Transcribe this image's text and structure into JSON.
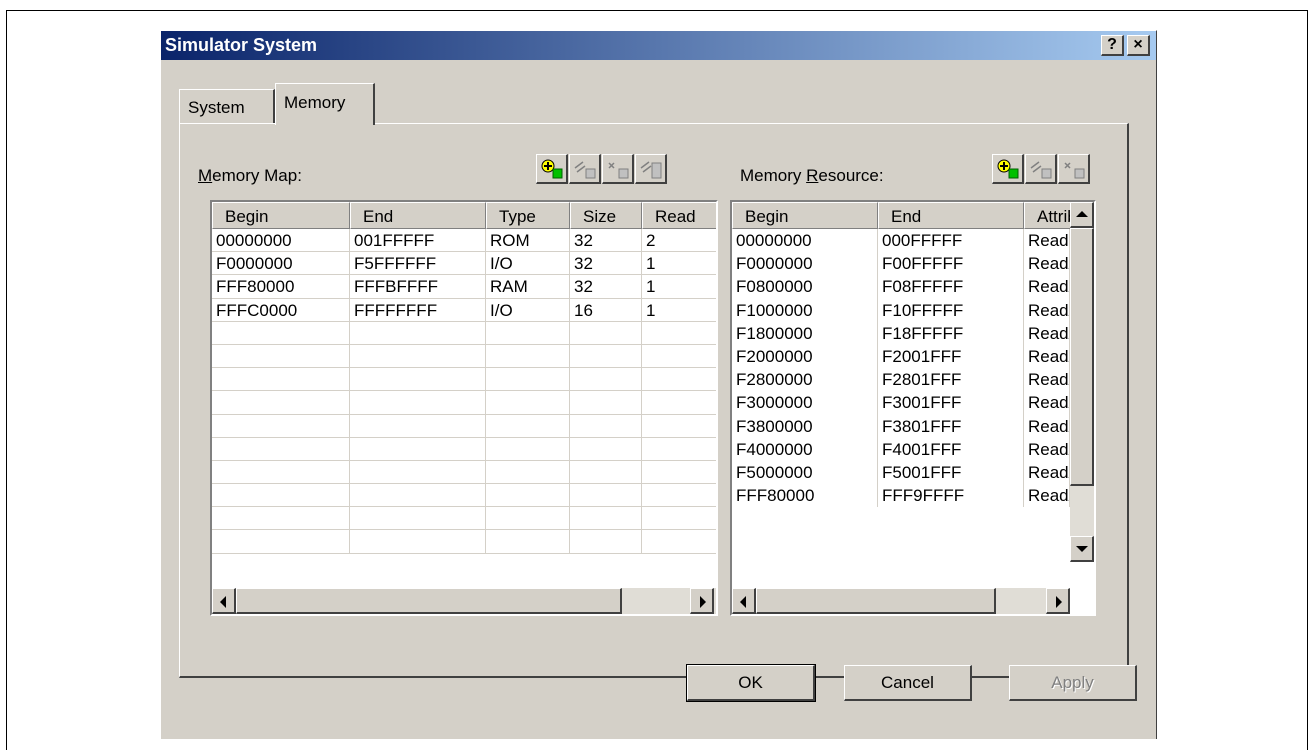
{
  "dialog": {
    "title": "Simulator System",
    "help_label": "?",
    "close_label": "×"
  },
  "tabs": [
    {
      "label": "System"
    },
    {
      "label": "Memory"
    }
  ],
  "memory_map": {
    "label_accel": "M",
    "label_rest": "emory Map:",
    "toolbar_icons": [
      "add-icon",
      "modify-icon",
      "delete-icon",
      "modify-all-icon"
    ],
    "columns": [
      "Begin",
      "End",
      "Type",
      "Size",
      "Read"
    ],
    "rows": [
      [
        "00000000",
        "001FFFFF",
        "ROM",
        "32",
        "2"
      ],
      [
        "F0000000",
        "F5FFFFFF",
        "I/O",
        "32",
        "1"
      ],
      [
        "FFF80000",
        "FFFBFFFF",
        "RAM",
        "32",
        "1"
      ],
      [
        "FFFC0000",
        "FFFFFFFF",
        "I/O",
        "16",
        "1"
      ],
      [
        "",
        "",
        "",
        "",
        ""
      ],
      [
        "",
        "",
        "",
        "",
        ""
      ],
      [
        "",
        "",
        "",
        "",
        ""
      ],
      [
        "",
        "",
        "",
        "",
        ""
      ],
      [
        "",
        "",
        "",
        "",
        ""
      ],
      [
        "",
        "",
        "",
        "",
        ""
      ],
      [
        "",
        "",
        "",
        "",
        ""
      ],
      [
        "",
        "",
        "",
        "",
        ""
      ],
      [
        "",
        "",
        "",
        "",
        ""
      ],
      [
        "",
        "",
        "",
        "",
        ""
      ]
    ]
  },
  "memory_resource": {
    "label_pre": "Memory ",
    "label_accel": "R",
    "label_rest": "esource:",
    "toolbar_icons": [
      "add-icon",
      "modify-icon",
      "delete-icon"
    ],
    "columns": [
      "Begin",
      "End",
      "Attribu"
    ],
    "rows": [
      [
        "00000000",
        "000FFFFF",
        "Read"
      ],
      [
        "F0000000",
        "F00FFFFF",
        "Read/"
      ],
      [
        "F0800000",
        "F08FFFFF",
        "Read/"
      ],
      [
        "F1000000",
        "F10FFFFF",
        "Read/"
      ],
      [
        "F1800000",
        "F18FFFFF",
        "Read/"
      ],
      [
        "F2000000",
        "F2001FFF",
        "Read/"
      ],
      [
        "F2800000",
        "F2801FFF",
        "Read/"
      ],
      [
        "F3000000",
        "F3001FFF",
        "Read/"
      ],
      [
        "F3800000",
        "F3801FFF",
        "Read/"
      ],
      [
        "F4000000",
        "F4001FFF",
        "Read/"
      ],
      [
        "F5000000",
        "F5001FFF",
        "Read/"
      ],
      [
        "FFF80000",
        "FFF9FFFF",
        "Read/"
      ]
    ]
  },
  "buttons": {
    "ok": "OK",
    "cancel": "Cancel",
    "apply": "Apply"
  }
}
